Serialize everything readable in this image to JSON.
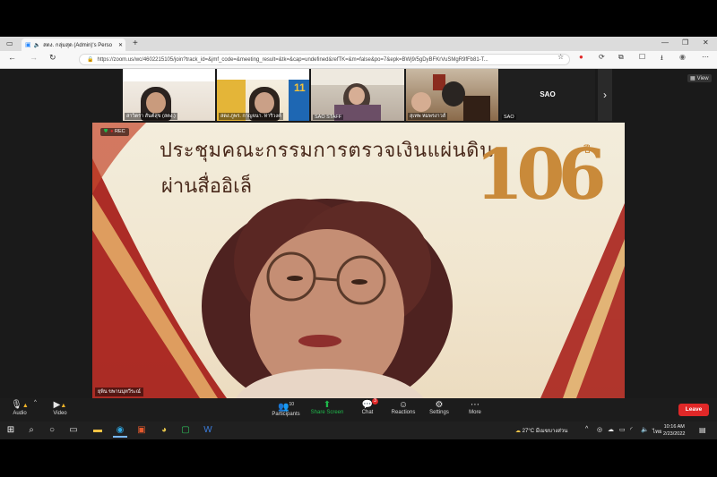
{
  "browser": {
    "tab_title": "สตง. กลุ่มสุด (Admin)'s Perso",
    "url": "https://zoom.us/wc/4602215105/join?track_id=&jmf_code=&meeting_result=&tk=&cap=undefined&refTK=&m=false&po=7&epk=BWj9/5gDyBFKrVuSMgR9fFb81-T...",
    "icons": [
      "back-icon",
      "forward-icon",
      "reload-icon",
      "lock-icon",
      "favorite-icon",
      "extensions-icon",
      "collections-icon",
      "profile-icon"
    ]
  },
  "zoom": {
    "thumbnails": [
      {
        "name": "สาวิตรา สันต์สุข (สตง.)"
      },
      {
        "name": "สตง.ภูพร. กาญจนา. ทาริวงค์"
      },
      {
        "name": "SAO STAFF"
      },
      {
        "name": "สุเทพ หมพรงาวส์"
      },
      {
        "name": "SAO"
      }
    ],
    "big_tile_label": "SAO",
    "view_label": "View",
    "rec_label": "REC",
    "main_headline_1": "ประชุมคณะกรรมการตรวจเงินแผ่นดิน",
    "main_headline_2": "ผ่านสื่ออิเล็",
    "anniversary_number": "106",
    "anniversary_suffix": "ปี",
    "main_speaker_name": "ยุพิน ขพานนุทวีระณ์",
    "toolbar": {
      "audio": "Audio",
      "video": "Video",
      "participants": "Participants",
      "participants_count": "10",
      "share_screen": "Share Screen",
      "chat": "Chat",
      "chat_badge": "3",
      "reactions": "Reactions",
      "settings": "Settings",
      "more": "More",
      "leave": "Leave"
    }
  },
  "taskbar": {
    "weather": "27°C  มีเมฆบางส่วน",
    "language": "ไทย",
    "time": "10:16 AM",
    "date": "2/23/2022"
  },
  "colors": {
    "accent_green": "#1fb84b",
    "leave_red": "#e02828",
    "headline_brown": "#4a2a1c",
    "gold": "#c98a3a"
  }
}
